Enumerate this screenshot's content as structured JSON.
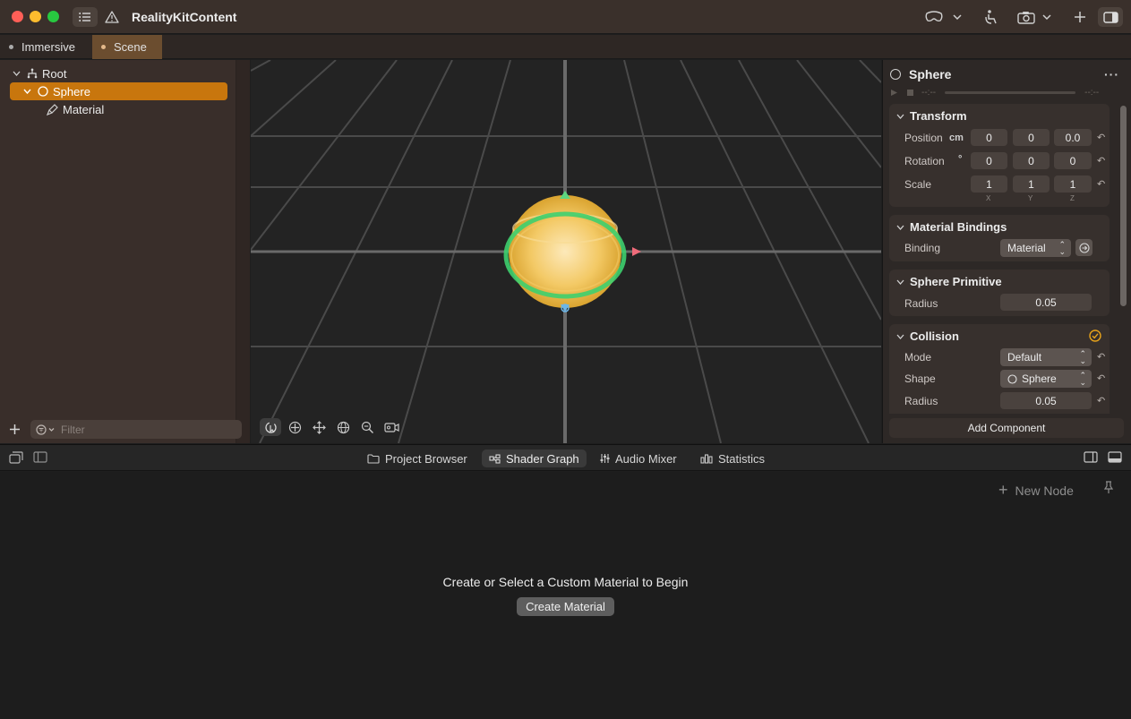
{
  "window": {
    "title": "RealityKitContent"
  },
  "tabs": [
    {
      "label": "Immersive"
    },
    {
      "label": "Scene"
    }
  ],
  "hierarchy": {
    "items": [
      {
        "label": "Root"
      },
      {
        "label": "Sphere"
      },
      {
        "label": "Material"
      }
    ],
    "filter_placeholder": "Filter"
  },
  "inspector": {
    "entity_name": "Sphere",
    "time_left": "--:--",
    "time_right": "--:--",
    "transform": {
      "title": "Transform",
      "position_label": "Position",
      "position_unit": "cm",
      "position": [
        "0",
        "0",
        "0.0"
      ],
      "rotation_label": "Rotation",
      "rotation_unit": "°",
      "rotation": [
        "0",
        "0",
        "0"
      ],
      "scale_label": "Scale",
      "scale": [
        "1",
        "1",
        "1"
      ],
      "axes": [
        "X",
        "Y",
        "Z"
      ]
    },
    "material_bindings": {
      "title": "Material Bindings",
      "binding_label": "Binding",
      "binding_value": "Material"
    },
    "sphere_primitive": {
      "title": "Sphere Primitive",
      "radius_label": "Radius",
      "radius_value": "0.05"
    },
    "collision": {
      "title": "Collision",
      "mode_label": "Mode",
      "mode_value": "Default",
      "shape_label": "Shape",
      "shape_value": "Sphere",
      "radius_label": "Radius",
      "radius_value": "0.05"
    },
    "add_component_label": "Add Component"
  },
  "bottom_tabs": [
    {
      "label": "Project Browser"
    },
    {
      "label": "Shader Graph"
    },
    {
      "label": "Audio Mixer"
    },
    {
      "label": "Statistics"
    }
  ],
  "shader_graph": {
    "new_node_label": "New Node",
    "empty_message": "Create or Select a Custom Material to Begin",
    "create_button_label": "Create Material"
  },
  "colors": {
    "accent_orange": "#c8760d",
    "selection_green": "#3ecf6e",
    "sphere_yellow": "#f0c24a"
  }
}
